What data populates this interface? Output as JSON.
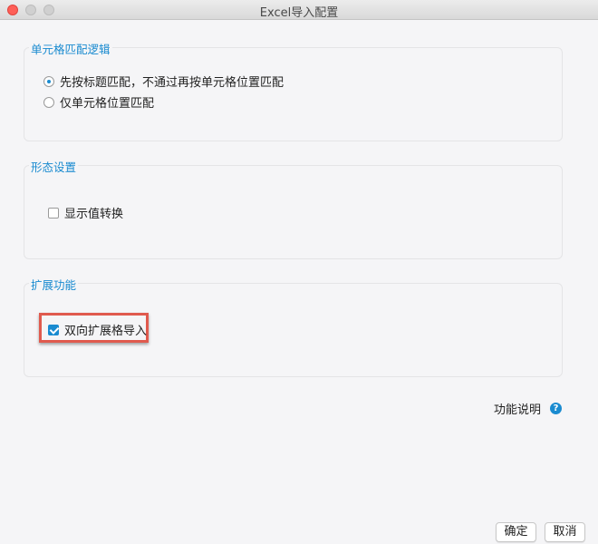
{
  "window": {
    "title": "Excel导入配置"
  },
  "cell_matching": {
    "title": "单元格匹配逻辑",
    "options": [
      {
        "label": "先按标题匹配，不通过再按单元格位置匹配",
        "selected": true
      },
      {
        "label": "仅单元格位置匹配",
        "selected": false
      }
    ]
  },
  "form_settings": {
    "title": "形态设置",
    "display_value_convert": {
      "label": "显示值转换",
      "checked": false
    }
  },
  "extension": {
    "title": "扩展功能",
    "bidirectional_import": {
      "label": "双向扩展格导入",
      "checked": true
    }
  },
  "help": {
    "label": "功能说明",
    "icon": "question-circle-icon",
    "glyph": "?"
  },
  "buttons": {
    "ok": "确定",
    "cancel": "取消"
  },
  "colors": {
    "accent": "#1a8bd0",
    "highlight": "#e05a4e",
    "close": "#fe5f57"
  }
}
